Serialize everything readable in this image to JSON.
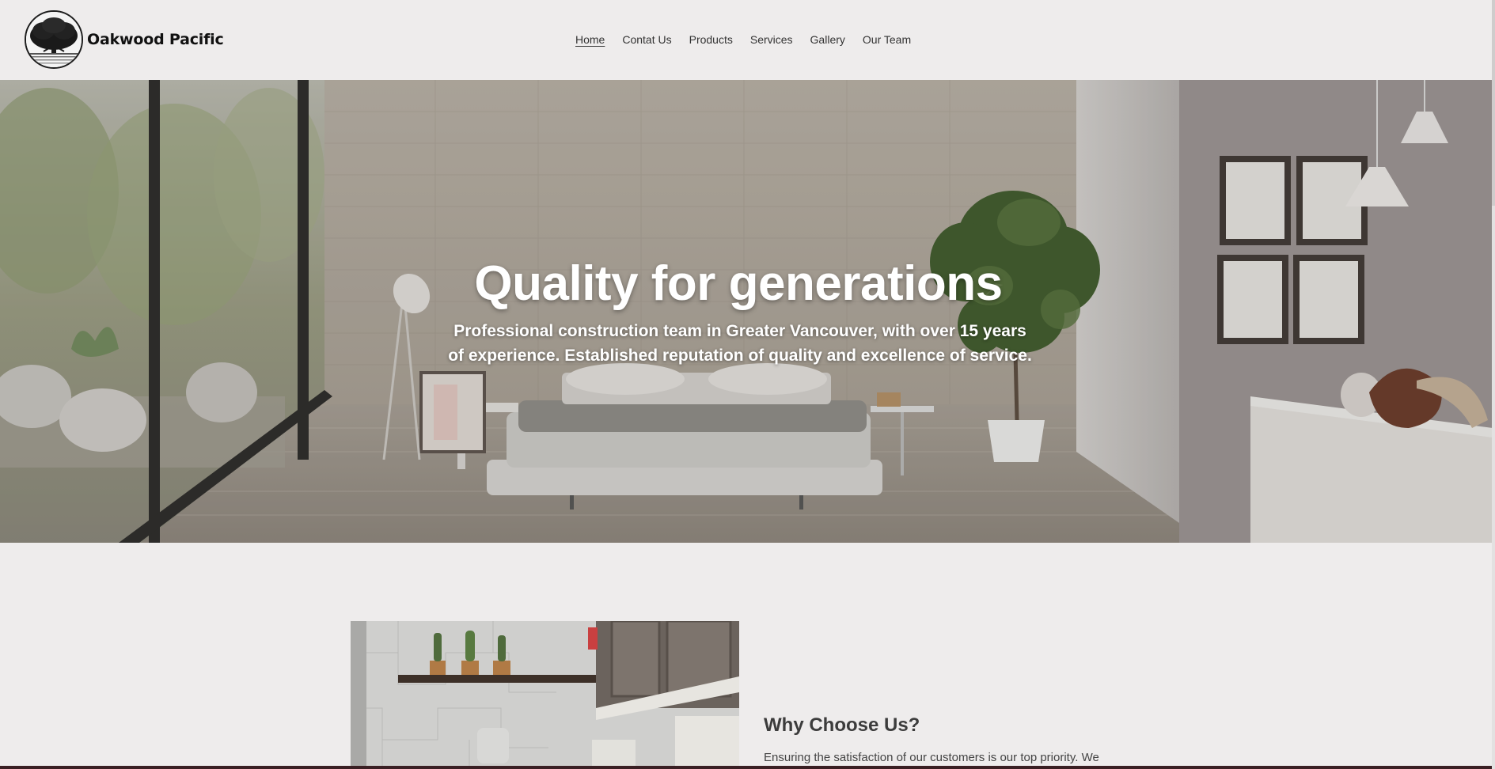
{
  "brand": {
    "name": "Oakwood Pacific",
    "logo_icon": "oak-tree-logo"
  },
  "nav": {
    "items": [
      {
        "label": "Home",
        "active": true
      },
      {
        "label": "Contat Us",
        "active": false
      },
      {
        "label": "Products",
        "active": false
      },
      {
        "label": "Services",
        "active": false
      },
      {
        "label": "Gallery",
        "active": false
      },
      {
        "label": "Our Team",
        "active": false
      }
    ]
  },
  "hero": {
    "title": "Quality for generations",
    "subtitle_line1": "Professional construction team in Greater Vancouver, with over 15 years",
    "subtitle_line2": "of experience. Established reputation of quality and excellence of service."
  },
  "why": {
    "title": "Why Choose Us?",
    "body": "Ensuring the satisfaction of our customers is our top priority. We"
  },
  "colors": {
    "background": "#eeecec",
    "text": "#3a3a3a",
    "hero_text": "#ffffff",
    "footer_strip": "#3a1f23"
  }
}
